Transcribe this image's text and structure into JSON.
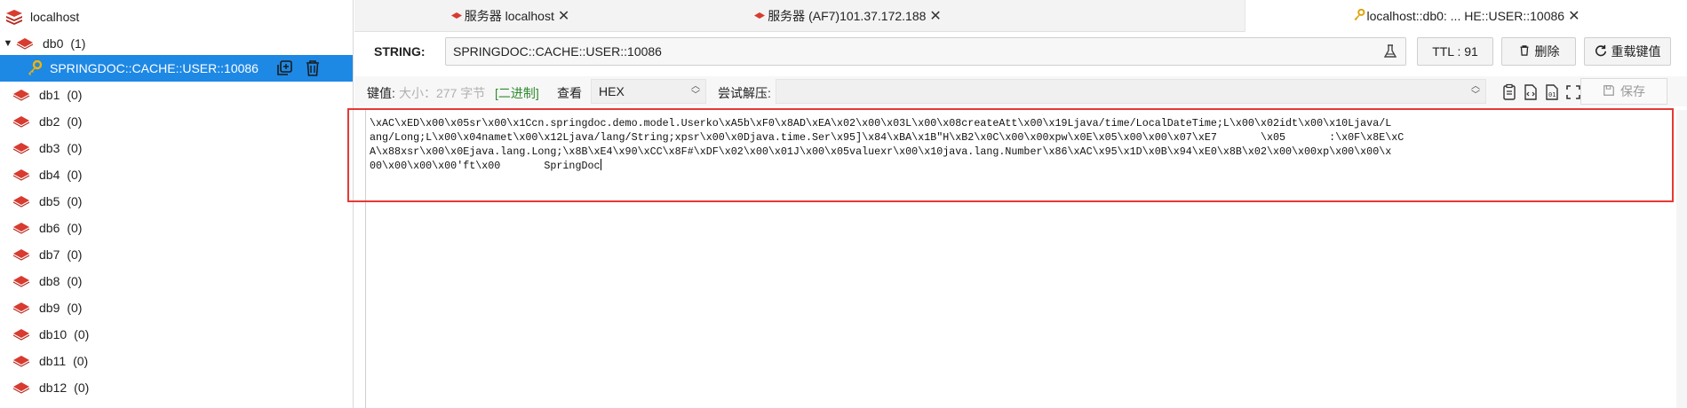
{
  "sidebar": {
    "connection": "localhost",
    "db0": {
      "label": "db0",
      "count": "(1)"
    },
    "selected_key": "SPRINGDOC::CACHE::USER::10086",
    "databases": [
      {
        "label": "db1",
        "count": "(0)"
      },
      {
        "label": "db2",
        "count": "(0)"
      },
      {
        "label": "db3",
        "count": "(0)"
      },
      {
        "label": "db4",
        "count": "(0)"
      },
      {
        "label": "db5",
        "count": "(0)"
      },
      {
        "label": "db6",
        "count": "(0)"
      },
      {
        "label": "db7",
        "count": "(0)"
      },
      {
        "label": "db8",
        "count": "(0)"
      },
      {
        "label": "db9",
        "count": "(0)"
      },
      {
        "label": "db10",
        "count": "(0)"
      },
      {
        "label": "db11",
        "count": "(0)"
      },
      {
        "label": "db12",
        "count": "(0)"
      }
    ]
  },
  "tabs": [
    {
      "label": "服务器 localhost"
    },
    {
      "label": "服务器 (AF7)101.37.172.188"
    },
    {
      "label": "localhost::db0: ... HE::USER::10086"
    }
  ],
  "header": {
    "type": "STRING:",
    "key": "SPRINGDOC::CACHE::USER::10086",
    "ttl": "TTL : 91",
    "delete": "删除",
    "rename": "重载键值"
  },
  "toolbar": {
    "value_label": "键值:",
    "size_label": "大小：277 字节",
    "binary_label": "[二进制]",
    "view_label": "查看",
    "view_format": "HEX",
    "decompress_label": "尝试解压:",
    "decompress_value": "",
    "save": "保存"
  },
  "value": {
    "line1": "\\xAC\\xED\\x00\\x05sr\\x00\\x1Ccn.springdoc.demo.model.Userko\\xA5b\\xF0\\x8AD\\xEA\\x02\\x00\\x03L\\x00\\x08createAtt\\x00\\x19Ljava/time/LocalDateTime;L\\x00\\x02idt\\x00\\x10Ljava/L",
    "line2": "ang/Long;L\\x00\\x04namet\\x00\\x12Ljava/lang/String;xpsr\\x00\\x0Djava.time.Ser\\x95]\\x84\\xBA\\x1B\"H\\xB2\\x0C\\x00\\x00xpw\\x0E\\x05\\x00\\x00\\x07\\xE7       \\x05       :\\x0F\\x8E\\xC",
    "line3": "A\\x88xsr\\x00\\x0Ejava.lang.Long;\\x8B\\xE4\\x90\\xCC\\x8F#\\xDF\\x02\\x00\\x01J\\x00\\x05valuexr\\x00\\x10java.lang.Number\\x86\\xAC\\x95\\x1D\\x0B\\x94\\xE0\\x8B\\x02\\x00\\x00xp\\x00\\x00\\x",
    "line4": "00\\x00\\x00\\x00'ft\\x00       SpringDoc"
  },
  "colors": {
    "accent": "#1e88e5",
    "redis": "#d83b2f",
    "highlight_box": "#e53935"
  },
  "icons": [
    "redis-stack-icon",
    "redis-db-icon",
    "key-icon",
    "copy-icon",
    "trash-icon",
    "close-icon",
    "flask-icon",
    "reload-icon",
    "clipboard-icon",
    "save-icon",
    "fullscreen-icon"
  ]
}
